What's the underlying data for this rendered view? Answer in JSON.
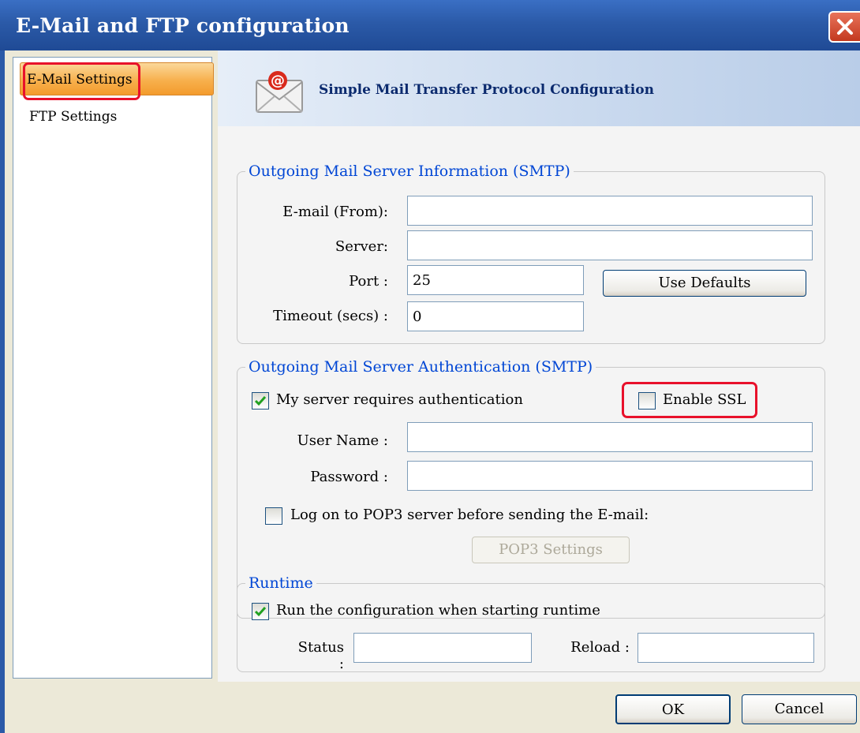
{
  "window": {
    "title": "E-Mail and FTP configuration"
  },
  "sidebar": {
    "items": [
      {
        "label": "E-Mail Settings",
        "selected": true
      },
      {
        "label": "FTP Settings",
        "selected": false
      }
    ]
  },
  "header": {
    "title": "Simple Mail Transfer Protocol Configuration",
    "icon": "email-envelope-icon"
  },
  "smtp_info": {
    "legend": "Outgoing Mail Server Information (SMTP)",
    "email_label": "E-mail (From):",
    "email_value": "",
    "server_label": "Server:",
    "server_value": "",
    "port_label": "Port :",
    "port_value": "25",
    "timeout_label": "Timeout (secs) :",
    "timeout_value": "0",
    "use_defaults_label": "Use Defaults"
  },
  "smtp_auth": {
    "legend": "Outgoing Mail Server Authentication (SMTP)",
    "requires_auth_label": "My server requires authentication",
    "requires_auth_checked": true,
    "ssl_label": "Enable SSL",
    "ssl_checked": false,
    "username_label": "User Name :",
    "username_value": "",
    "password_label": "Password :",
    "password_value": "",
    "pop3_label": "Log on to POP3 server before sending the E-mail:",
    "pop3_checked": false,
    "pop3_settings_label": "POP3 Settings"
  },
  "runtime": {
    "legend": "Runtime",
    "run_label": "Run the configuration when starting runtime",
    "run_checked": true,
    "status_label": "Status :",
    "status_value": "",
    "reload_label": "Reload :",
    "reload_value": ""
  },
  "footer": {
    "ok_label": "OK",
    "cancel_label": "Cancel"
  },
  "colors": {
    "highlight": "#e8112b",
    "title_bar": "#2b5aa8",
    "legend_text": "#0046d5",
    "selected_item": "#f7b04d"
  }
}
